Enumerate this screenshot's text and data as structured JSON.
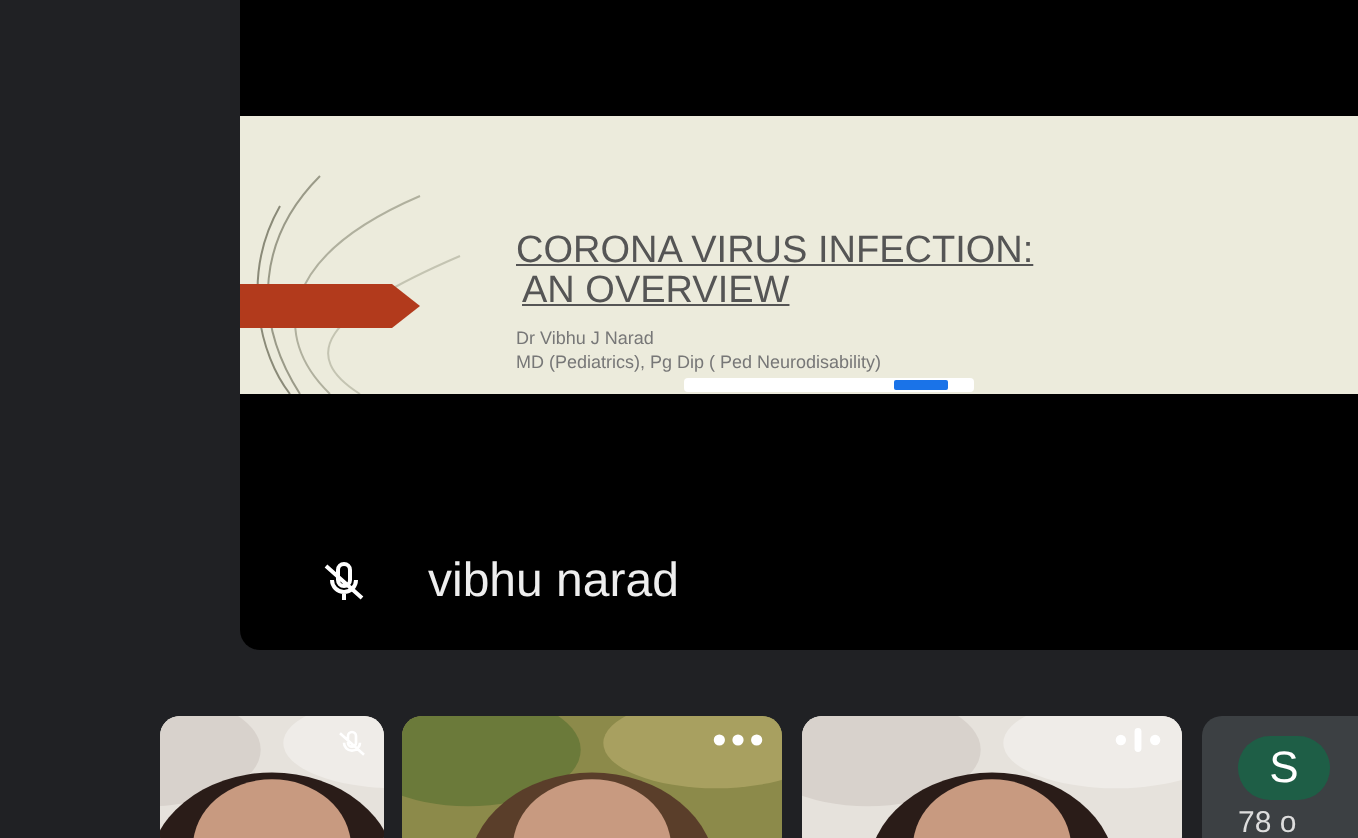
{
  "presenter": {
    "name": "vibhu narad",
    "muted": true
  },
  "slide": {
    "title_lines": [
      "CORONA VIRUS INFECTION:",
      "AN OVERVIEW"
    ],
    "author": "Dr Vibhu J Narad",
    "credentials": "MD (Pediatrics), Pg Dip ( Ped Neurodisability)"
  },
  "participants": [
    {
      "kind": "muted"
    },
    {
      "kind": "menu"
    },
    {
      "kind": "speaking"
    },
    {
      "kind": "avatar",
      "initial": "S",
      "color": "#1e5e46",
      "caption": "78 o"
    }
  ]
}
